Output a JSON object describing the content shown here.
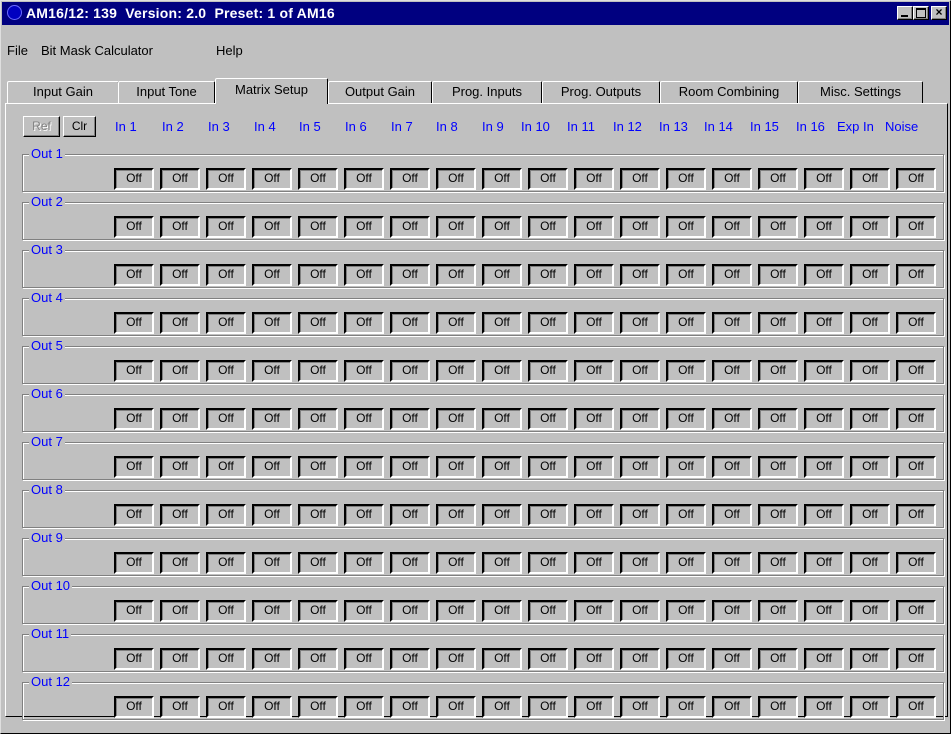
{
  "window": {
    "title": "AM16/12: 139  Version: 2.0  Preset: 1 of AM16",
    "title_bar_color": "#000080",
    "controls": [
      "minimize-icon",
      "maximize-icon",
      "close-icon"
    ],
    "close_label": "×"
  },
  "menu": {
    "items": [
      {
        "label": "File"
      },
      {
        "label": "Bit Mask Calculator"
      },
      {
        "label": "Help"
      }
    ]
  },
  "tabs": {
    "items": [
      {
        "label": "Input Gain"
      },
      {
        "label": "Input Tone"
      },
      {
        "label": "Matrix Setup"
      },
      {
        "label": "Output Gain"
      },
      {
        "label": "Prog. Inputs"
      },
      {
        "label": "Prog. Outputs"
      },
      {
        "label": "Room Combining"
      },
      {
        "label": "Misc. Settings"
      }
    ],
    "active": "Matrix Setup"
  },
  "matrix": {
    "ref_label": "Ref",
    "clr_label": "Clr",
    "label_color": "#0000ff",
    "columns": [
      "In 1",
      "In 2",
      "In 3",
      "In 4",
      "In 5",
      "In 6",
      "In 7",
      "In 8",
      "In 9",
      "In 10",
      "In 11",
      "In 12",
      "In 13",
      "In 14",
      "In 15",
      "In 16",
      "Exp In",
      "Noise"
    ],
    "rows": [
      {
        "label": "Out 1",
        "values": [
          "Off",
          "Off",
          "Off",
          "Off",
          "Off",
          "Off",
          "Off",
          "Off",
          "Off",
          "Off",
          "Off",
          "Off",
          "Off",
          "Off",
          "Off",
          "Off",
          "Off",
          "Off"
        ]
      },
      {
        "label": "Out 2",
        "values": [
          "Off",
          "Off",
          "Off",
          "Off",
          "Off",
          "Off",
          "Off",
          "Off",
          "Off",
          "Off",
          "Off",
          "Off",
          "Off",
          "Off",
          "Off",
          "Off",
          "Off",
          "Off"
        ]
      },
      {
        "label": "Out 3",
        "values": [
          "Off",
          "Off",
          "Off",
          "Off",
          "Off",
          "Off",
          "Off",
          "Off",
          "Off",
          "Off",
          "Off",
          "Off",
          "Off",
          "Off",
          "Off",
          "Off",
          "Off",
          "Off"
        ]
      },
      {
        "label": "Out 4",
        "values": [
          "Off",
          "Off",
          "Off",
          "Off",
          "Off",
          "Off",
          "Off",
          "Off",
          "Off",
          "Off",
          "Off",
          "Off",
          "Off",
          "Off",
          "Off",
          "Off",
          "Off",
          "Off"
        ]
      },
      {
        "label": "Out 5",
        "values": [
          "Off",
          "Off",
          "Off",
          "Off",
          "Off",
          "Off",
          "Off",
          "Off",
          "Off",
          "Off",
          "Off",
          "Off",
          "Off",
          "Off",
          "Off",
          "Off",
          "Off",
          "Off"
        ]
      },
      {
        "label": "Out 6",
        "values": [
          "Off",
          "Off",
          "Off",
          "Off",
          "Off",
          "Off",
          "Off",
          "Off",
          "Off",
          "Off",
          "Off",
          "Off",
          "Off",
          "Off",
          "Off",
          "Off",
          "Off",
          "Off"
        ]
      },
      {
        "label": "Out 7",
        "values": [
          "Off",
          "Off",
          "Off",
          "Off",
          "Off",
          "Off",
          "Off",
          "Off",
          "Off",
          "Off",
          "Off",
          "Off",
          "Off",
          "Off",
          "Off",
          "Off",
          "Off",
          "Off"
        ]
      },
      {
        "label": "Out 8",
        "values": [
          "Off",
          "Off",
          "Off",
          "Off",
          "Off",
          "Off",
          "Off",
          "Off",
          "Off",
          "Off",
          "Off",
          "Off",
          "Off",
          "Off",
          "Off",
          "Off",
          "Off",
          "Off"
        ]
      },
      {
        "label": "Out 9",
        "values": [
          "Off",
          "Off",
          "Off",
          "Off",
          "Off",
          "Off",
          "Off",
          "Off",
          "Off",
          "Off",
          "Off",
          "Off",
          "Off",
          "Off",
          "Off",
          "Off",
          "Off",
          "Off"
        ]
      },
      {
        "label": "Out 10",
        "values": [
          "Off",
          "Off",
          "Off",
          "Off",
          "Off",
          "Off",
          "Off",
          "Off",
          "Off",
          "Off",
          "Off",
          "Off",
          "Off",
          "Off",
          "Off",
          "Off",
          "Off",
          "Off"
        ]
      },
      {
        "label": "Out 11",
        "values": [
          "Off",
          "Off",
          "Off",
          "Off",
          "Off",
          "Off",
          "Off",
          "Off",
          "Off",
          "Off",
          "Off",
          "Off",
          "Off",
          "Off",
          "Off",
          "Off",
          "Off",
          "Off"
        ]
      },
      {
        "label": "Out 12",
        "values": [
          "Off",
          "Off",
          "Off",
          "Off",
          "Off",
          "Off",
          "Off",
          "Off",
          "Off",
          "Off",
          "Off",
          "Off",
          "Off",
          "Off",
          "Off",
          "Off",
          "Off",
          "Off"
        ]
      }
    ]
  }
}
